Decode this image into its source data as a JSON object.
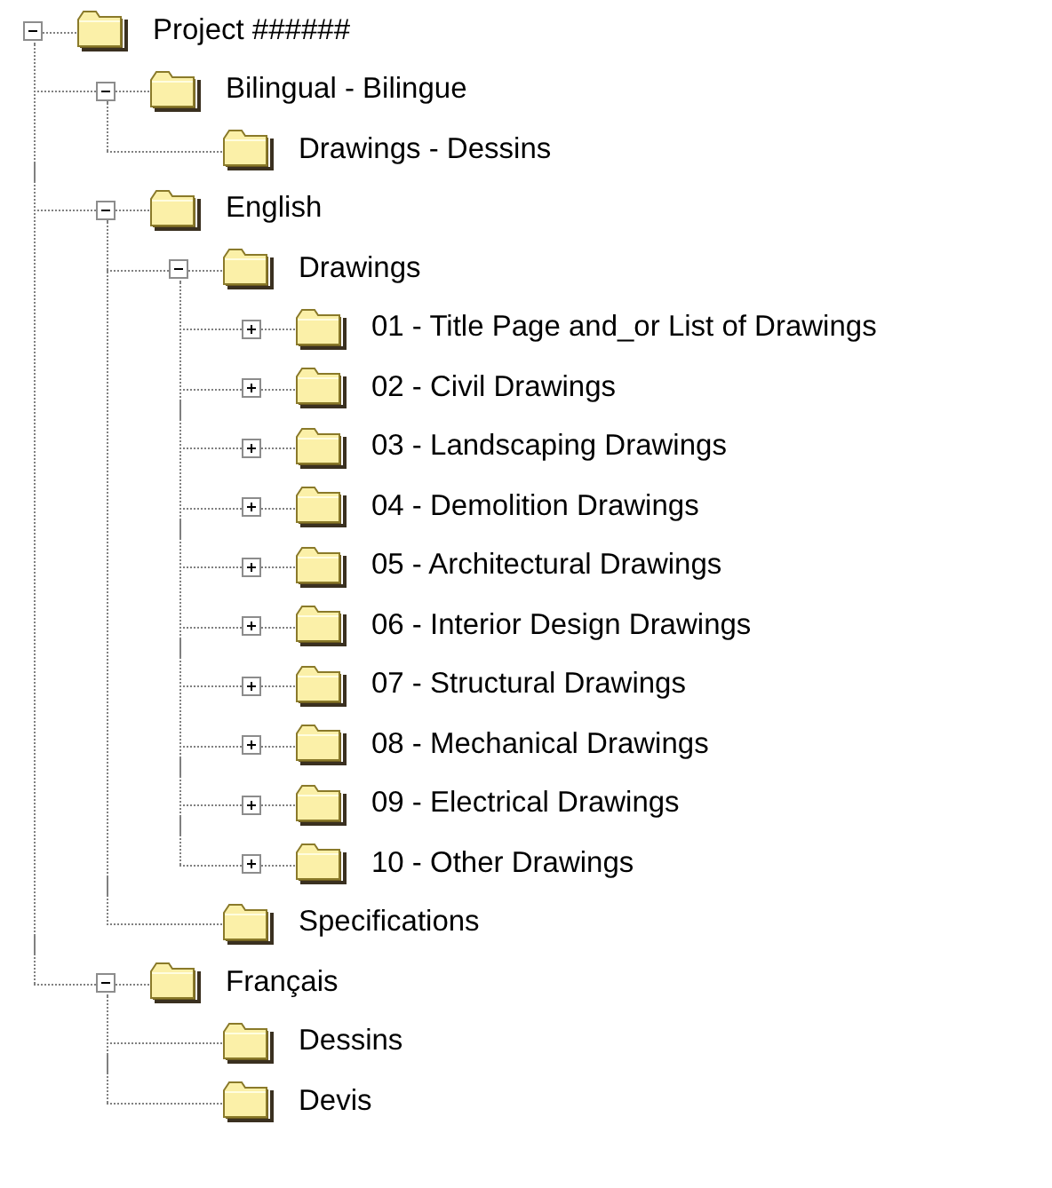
{
  "tree": [
    {
      "label": "Project ######",
      "expanded": true,
      "children": [
        {
          "label": "Bilingual - Bilingue",
          "expanded": true,
          "children": [
            {
              "label": "Drawings - Dessins"
            }
          ]
        },
        {
          "label": "English",
          "expanded": true,
          "children": [
            {
              "label": "Drawings",
              "expanded": true,
              "children": [
                {
                  "label": "01 - Title Page and_or List of Drawings",
                  "expanded": false
                },
                {
                  "label": "02 - Civil Drawings",
                  "expanded": false
                },
                {
                  "label": "03 - Landscaping Drawings",
                  "expanded": false
                },
                {
                  "label": "04 - Demolition Drawings",
                  "expanded": false
                },
                {
                  "label": "05 - Architectural Drawings",
                  "expanded": false
                },
                {
                  "label": "06 - Interior Design Drawings",
                  "expanded": false
                },
                {
                  "label": "07 - Structural Drawings",
                  "expanded": false
                },
                {
                  "label": "08 - Mechanical Drawings",
                  "expanded": false
                },
                {
                  "label": "09 - Electrical Drawings",
                  "expanded": false
                },
                {
                  "label": "10 - Other Drawings",
                  "expanded": false
                }
              ]
            },
            {
              "label": "Specifications"
            }
          ]
        },
        {
          "label": "Français",
          "expanded": true,
          "children": [
            {
              "label": "Dessins"
            },
            {
              "label": "Devis"
            }
          ]
        }
      ]
    }
  ]
}
